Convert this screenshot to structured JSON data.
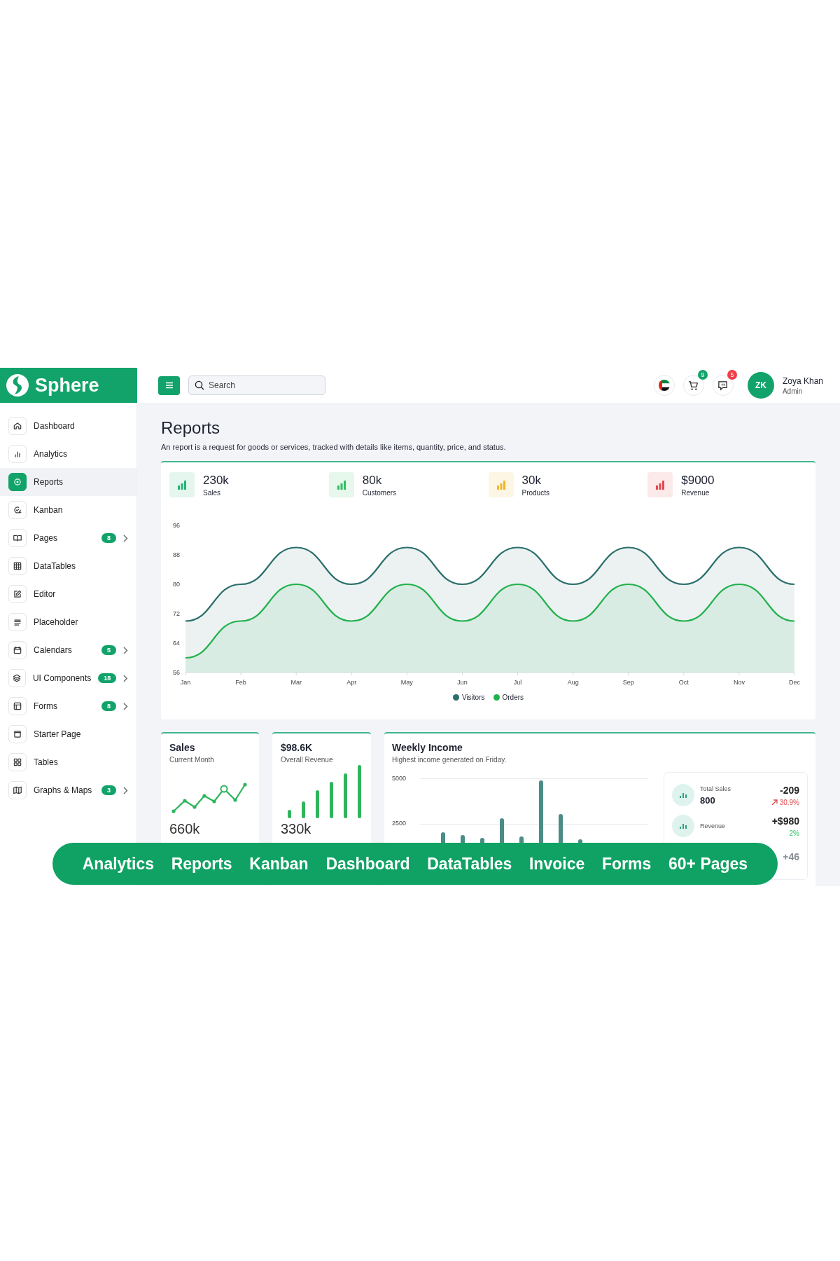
{
  "brand": {
    "name": "Sphere"
  },
  "search": {
    "placeholder": "Search"
  },
  "header": {
    "cart_count": "9",
    "messages_count": "5",
    "user": {
      "initials": "ZK",
      "name": "Zoya Khan",
      "role": "Admin"
    }
  },
  "sidebar": {
    "items": [
      {
        "label": "Dashboard",
        "selected": false,
        "has_submenu": false
      },
      {
        "label": "Analytics",
        "selected": false,
        "has_submenu": false
      },
      {
        "label": "Reports",
        "selected": true,
        "has_submenu": false
      },
      {
        "label": "Kanban",
        "selected": false,
        "has_submenu": false
      },
      {
        "label": "Pages",
        "selected": false,
        "has_submenu": true,
        "badge": "8"
      },
      {
        "label": "DataTables",
        "selected": false,
        "has_submenu": false
      },
      {
        "label": "Editor",
        "selected": false,
        "has_submenu": false
      },
      {
        "label": "Placeholder",
        "selected": false,
        "has_submenu": false
      },
      {
        "label": "Calendars",
        "selected": false,
        "has_submenu": true,
        "badge": "5"
      },
      {
        "label": "UI Components",
        "selected": false,
        "has_submenu": true,
        "badge": "18"
      },
      {
        "label": "Forms",
        "selected": false,
        "has_submenu": true,
        "badge": "8"
      },
      {
        "label": "Starter Page",
        "selected": false,
        "has_submenu": false
      },
      {
        "label": "Tables",
        "selected": false,
        "has_submenu": false
      },
      {
        "label": "Graphs & Maps",
        "selected": false,
        "has_submenu": true,
        "badge": "3"
      }
    ]
  },
  "page": {
    "title": "Reports",
    "description": "An report is a request for goods or services, tracked with details like items, quantity, price, and status."
  },
  "overview": {
    "stats": [
      {
        "value": "230k",
        "label": "Sales",
        "color": "#22b573"
      },
      {
        "value": "80k",
        "label": "Customers",
        "color": "#2fbf5f"
      },
      {
        "value": "30k",
        "label": "Products",
        "color": "#f2b52a"
      },
      {
        "value": "$9000",
        "label": "Revenue",
        "color": "#e5484d"
      }
    ],
    "chart_data": {
      "type": "area",
      "categories": [
        "Jan",
        "Feb",
        "Mar",
        "Apr",
        "May",
        "Jun",
        "Jul",
        "Aug",
        "Sep",
        "Oct",
        "Nov",
        "Dec"
      ],
      "series": [
        {
          "name": "Visitors",
          "color": "#2a6f6b",
          "values": [
            70,
            80,
            90,
            80,
            90,
            80,
            90,
            80,
            90,
            80,
            90,
            80
          ]
        },
        {
          "name": "Orders",
          "color": "#22b14c",
          "values": [
            60,
            70,
            80,
            70,
            80,
            70,
            80,
            70,
            80,
            70,
            80,
            70
          ]
        }
      ],
      "ylim": [
        56,
        96
      ],
      "yticks": [
        56,
        64,
        72,
        80,
        88,
        96
      ]
    }
  },
  "sales_card": {
    "title": "Sales",
    "subtitle": "Current Month",
    "value": "660k"
  },
  "revenue_card": {
    "title": "$98.6K",
    "subtitle": "Overall Revenue",
    "value": "330k"
  },
  "weekly_income": {
    "title": "Weekly Income",
    "subtitle": "Highest income generated on Friday.",
    "axis_labels": [
      "5000",
      "2500"
    ],
    "summary": [
      {
        "label": "Total Sales",
        "value": "800",
        "change": "-209",
        "delta": "30.9%",
        "negative": true
      },
      {
        "label": "Revenue",
        "change": "+$980",
        "delta": "2%",
        "negative": false
      },
      {
        "change": "+46"
      }
    ]
  },
  "banner": [
    "Analytics",
    "Reports",
    "Kanban",
    "Dashboard",
    "DataTables",
    "Invoice",
    "Forms",
    "60+ Pages"
  ]
}
